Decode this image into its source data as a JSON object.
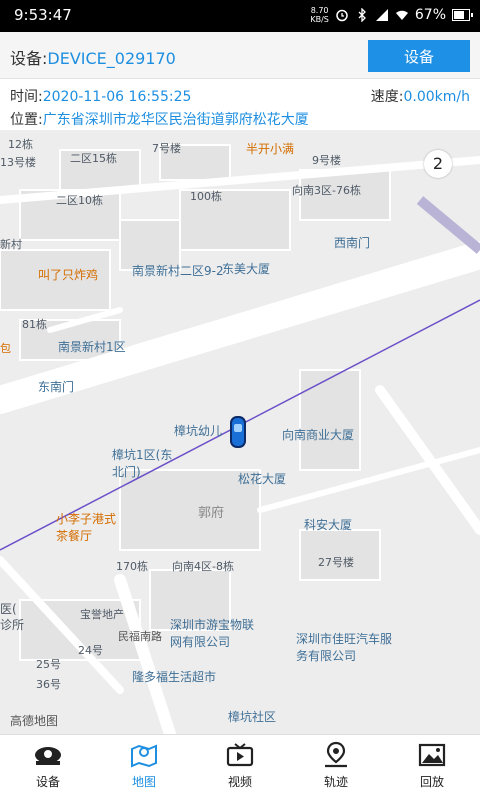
{
  "status": {
    "time": "9:53:47",
    "net_speed_top": "8.70",
    "net_speed_unit": "KB/S",
    "battery": "67%"
  },
  "device": {
    "label": "设备:",
    "id": "DEVICE_029170",
    "button": "设备"
  },
  "info": {
    "time_label": "时间:",
    "time_value": "2020-11-06 16:55:25",
    "speed_label": "速度:",
    "speed_value": "0.00km/h",
    "location_label": "位置:",
    "location_value": "广东省深圳市龙华区民治街道郭府松花大厦"
  },
  "map": {
    "zoom_badge": "2",
    "provider_logo": "高德地图",
    "labels": [
      {
        "text": "12栋"
      },
      {
        "text": "二区15栋"
      },
      {
        "text": "13号楼"
      },
      {
        "text": "二区10栋"
      },
      {
        "text": "新村"
      },
      {
        "text": "7号楼"
      },
      {
        "text": "9号楼"
      },
      {
        "text": "100栋"
      },
      {
        "text": "向南3区-76栋"
      },
      {
        "text": "81栋"
      },
      {
        "text": "向南4区-8栋"
      },
      {
        "text": "170栋"
      },
      {
        "text": "27号楼"
      },
      {
        "text": "郭府"
      },
      {
        "text": "宝誉地产"
      },
      {
        "text": "24号"
      },
      {
        "text": "25号"
      },
      {
        "text": "36号"
      },
      {
        "text": "民福南路"
      },
      {
        "text": "医("
      },
      {
        "text": "诊所"
      },
      {
        "text": "包"
      }
    ],
    "pois": [
      {
        "text": "南景新村二区9-2"
      },
      {
        "text": "东美大厦"
      },
      {
        "text": "西南门"
      },
      {
        "text": "南景新村1区"
      },
      {
        "text": "东南门"
      },
      {
        "text": "樟坑幼儿"
      },
      {
        "text": "向南商业大厦"
      },
      {
        "text": "樟坑1区(东北门)"
      },
      {
        "text": "松花大厦"
      },
      {
        "text": "科安大厦"
      },
      {
        "text": "深圳市游宝物联网有限公司"
      },
      {
        "text": "深圳市佳旺汽车服务有限公司"
      },
      {
        "text": "隆多福生活超市"
      },
      {
        "text": "樟坑社区"
      }
    ],
    "orange_pois": [
      {
        "text": "半开小满"
      },
      {
        "text": "叫了只炸鸡"
      },
      {
        "text": "小李子港式茶餐厅"
      }
    ]
  },
  "nav": {
    "tabs": [
      {
        "label": "设备",
        "icon": "device-icon"
      },
      {
        "label": "地图",
        "icon": "map-icon",
        "active": true
      },
      {
        "label": "视频",
        "icon": "video-icon"
      },
      {
        "label": "轨迹",
        "icon": "track-icon"
      },
      {
        "label": "回放",
        "icon": "playback-icon"
      }
    ]
  },
  "colors": {
    "accent": "#1e8fe0",
    "button": "#1e90e6",
    "track": "#6b4fc8"
  }
}
